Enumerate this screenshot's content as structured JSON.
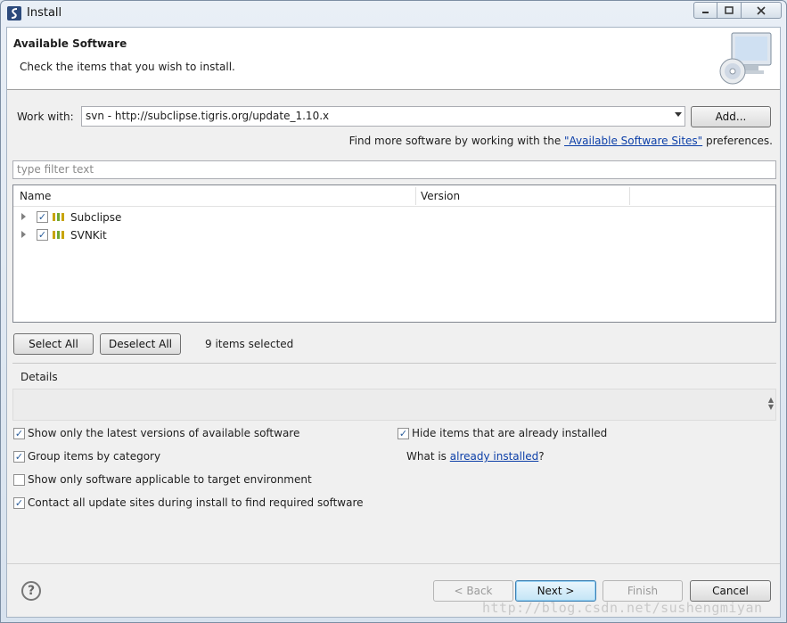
{
  "window": {
    "title": "Install"
  },
  "banner": {
    "title": "Available Software",
    "description": "Check the items that you wish to install."
  },
  "work_with": {
    "label": "Work with:",
    "value": "svn - http://subclipse.tigris.org/update_1.10.x",
    "add_label": "Add..."
  },
  "more_software": {
    "prefix": "Find more software by working with the ",
    "link": "\"Available Software Sites\"",
    "suffix": " preferences."
  },
  "filter": {
    "placeholder": "type filter text"
  },
  "tree": {
    "columns": [
      "Name",
      "Version"
    ],
    "items": [
      {
        "label": "Subclipse",
        "checked": true
      },
      {
        "label": "SVNKit",
        "checked": true
      }
    ]
  },
  "selection": {
    "select_all": "Select All",
    "deselect_all": "Deselect All",
    "count_text": "9 items selected"
  },
  "details": {
    "label": "Details"
  },
  "options": {
    "latest_versions": "Show only the latest versions of available software",
    "group_by_category": "Group items by category",
    "applicable_only": "Show only software applicable to target environment",
    "contact_all_sites": "Contact all update sites during install to find required software",
    "hide_installed": "Hide items that are already installed",
    "what_is_prefix": "What is ",
    "what_is_link": "already installed",
    "what_is_suffix": "?"
  },
  "option_states": {
    "latest_versions": true,
    "group_by_category": true,
    "applicable_only": false,
    "contact_all_sites": true,
    "hide_installed": true
  },
  "footer": {
    "back": "< Back",
    "next": "Next >",
    "finish": "Finish",
    "cancel": "Cancel"
  },
  "watermark": "http://blog.csdn.net/sushengmiyan",
  "colors": {
    "link": "#0c3fa8",
    "default_button": "#3c7fb1"
  },
  "icons": [
    "eclipse-app-icon",
    "minimize-icon",
    "maximize-icon",
    "close-icon",
    "install-cd-icon",
    "expand-arrow-icon",
    "feature-group-icon",
    "help-icon"
  ]
}
